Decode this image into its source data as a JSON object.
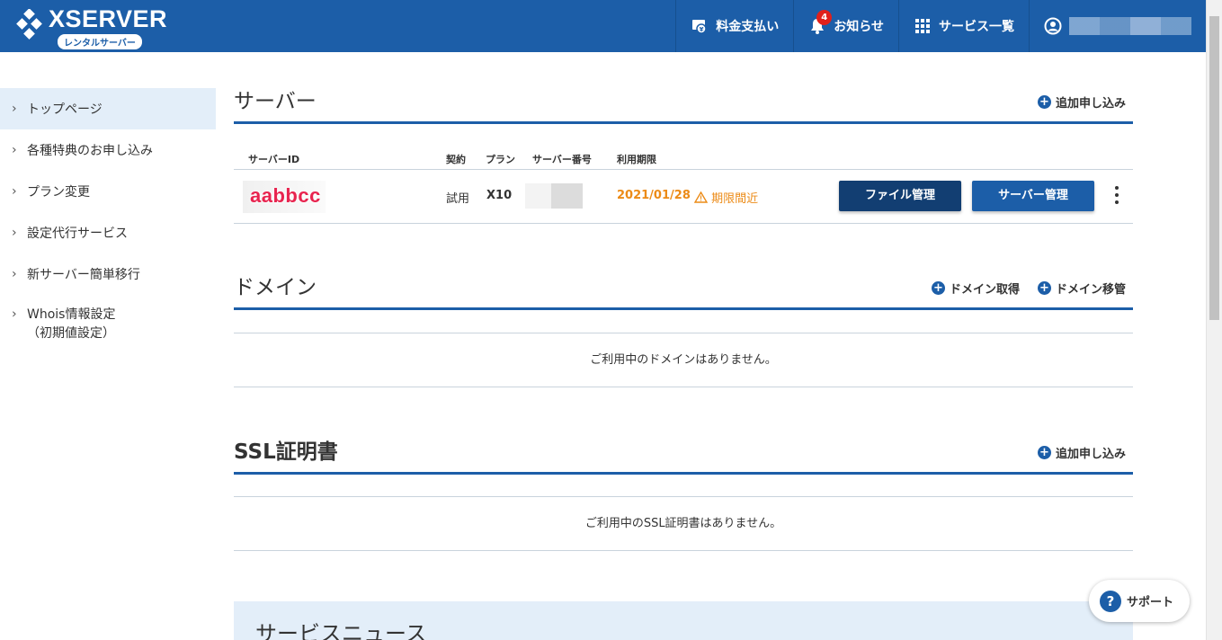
{
  "header": {
    "logo_text": "XSERVER",
    "logo_sub": "レンタルサーバー",
    "nav": {
      "billing": "料金支払い",
      "notices": "お知らせ",
      "notices_badge": "4",
      "services": "サービス一覧"
    }
  },
  "sidebar": {
    "items": [
      {
        "label": "トップページ"
      },
      {
        "label": "各種特典のお申し込み"
      },
      {
        "label": "プラン変更"
      },
      {
        "label": "設定代行サービス"
      },
      {
        "label": "新サーバー簡単移行"
      },
      {
        "label": "Whois情報設定",
        "sub": "（初期値設定）"
      }
    ]
  },
  "server_section": {
    "title": "サーバー",
    "add_link": "追加申し込み",
    "columns": [
      "サーバーID",
      "契約",
      "プラン",
      "サーバー番号",
      "利用期限"
    ],
    "row": {
      "server_id": "aabbcc",
      "contract": "試用",
      "plan": "X10",
      "expiry": "2021/01/28",
      "warning": "期限間近",
      "file_btn": "ファイル管理",
      "server_btn": "サーバー管理"
    }
  },
  "domain_section": {
    "title": "ドメイン",
    "link_get": "ドメイン取得",
    "link_transfer": "ドメイン移管",
    "empty_message": "ご利用中のドメインはありません。"
  },
  "ssl_section": {
    "title": "SSL証明書",
    "add_link": "追加申し込み",
    "empty_message": "ご利用中のSSL証明書はありません。"
  },
  "news_section": {
    "title": "サービスニュース"
  },
  "support_button": "サポート",
  "colors": {
    "brand": "#1c5ea8",
    "dark_button": "#123e72",
    "warning": "#ec8b17",
    "badge": "#e0201b"
  }
}
